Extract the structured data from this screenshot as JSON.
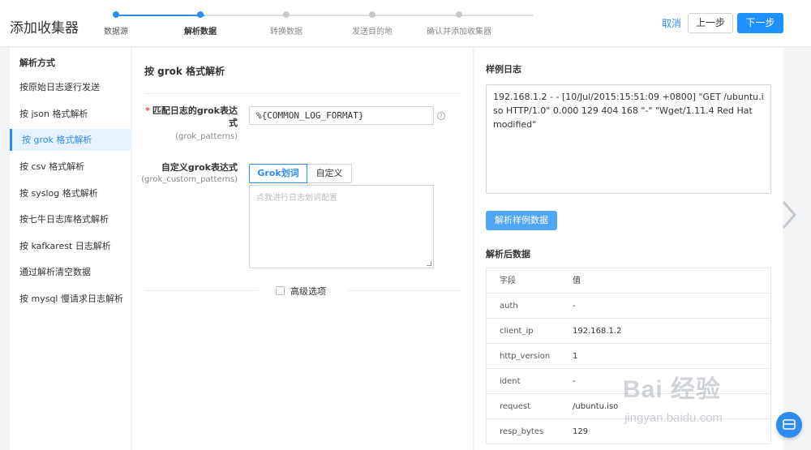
{
  "header": {
    "title": "添加收集器",
    "cancel_label": "取消",
    "prev_label": "上一步",
    "next_label": "下一步"
  },
  "steps": [
    {
      "label": "数据源",
      "state": "done"
    },
    {
      "label": "解析数据",
      "state": "current"
    },
    {
      "label": "转换数据",
      "state": "todo"
    },
    {
      "label": "发送目的地",
      "state": "todo"
    },
    {
      "label": "确认并添加收集器",
      "state": "todo"
    }
  ],
  "sidebar": {
    "title": "解析方式",
    "items": [
      {
        "label": "按原始日志逐行发送"
      },
      {
        "label": "按 json 格式解析"
      },
      {
        "label": "按 grok 格式解析"
      },
      {
        "label": "按 csv 格式解析"
      },
      {
        "label": "按 syslog 格式解析"
      },
      {
        "label": "按七牛日志库格式解析"
      },
      {
        "label": "按 kafkarest 日志解析"
      },
      {
        "label": "通过解析清空数据"
      },
      {
        "label": "按 mysql 慢请求日志解析"
      }
    ]
  },
  "form": {
    "section_title": "按 grok 格式解析",
    "pattern_label_line1": "匹配日志的grok表达",
    "pattern_label_line2": "式",
    "pattern_sub": "(grok_patterns)",
    "pattern_value": "%{COMMON_LOG_FORMAT}",
    "custom_label": "自定义grok表达式",
    "custom_sub": "(grok_custom_patterns)",
    "tab_grok": "Grok划词",
    "tab_custom": "自定义",
    "textarea_placeholder": "点我进行日志划词配置",
    "advanced_label": "高级选项"
  },
  "right": {
    "sample_title": "样例日志",
    "sample_text": "192.168.1.2 - - [10/Jul/2015:15:51:09 +0800] \"GET /ubuntu.iso HTTP/1.0\" 0.000 129 404 168 \"-\" \"Wget/1.11.4 Red Hat modified\"",
    "parse_button": "解析样例数据",
    "parsed_title": "解析后数据",
    "table_head": {
      "k": "字段",
      "v": "值"
    },
    "rows": [
      {
        "k": "auth",
        "v": "-"
      },
      {
        "k": "client_ip",
        "v": "192.168.1.2"
      },
      {
        "k": "http_version",
        "v": "1"
      },
      {
        "k": "ident",
        "v": "-"
      },
      {
        "k": "request",
        "v": "/ubuntu.iso"
      },
      {
        "k": "resp_bytes",
        "v": "129"
      }
    ]
  },
  "watermark": {
    "brand": "Bai 经验",
    "url": "jingyan.baidu.com"
  },
  "colors": {
    "accent": "#2d8cf0",
    "required": "#e93e3e"
  }
}
